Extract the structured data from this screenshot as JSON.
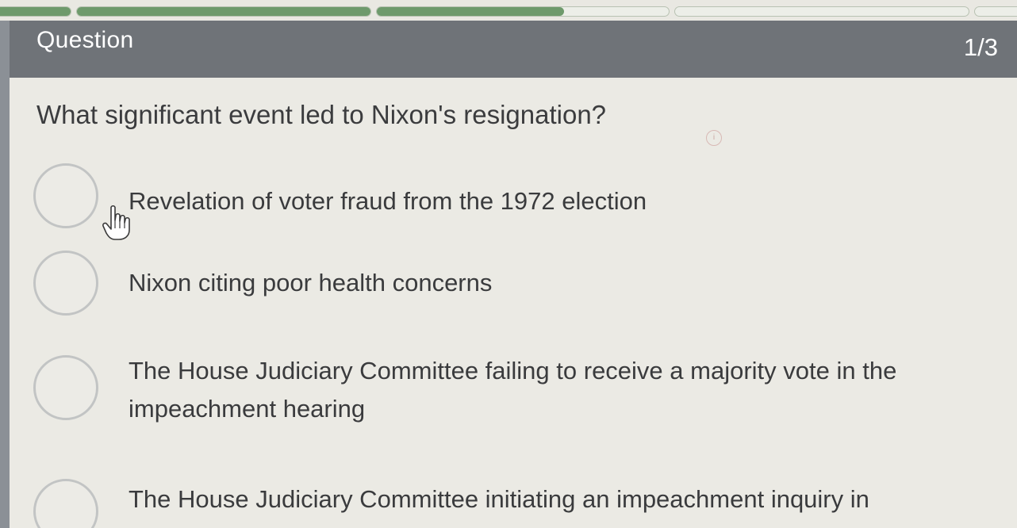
{
  "header": {
    "title": "Question",
    "counter": "1/3"
  },
  "progress": {
    "segments": [
      {
        "fill": 1.0
      },
      {
        "fill": 1.0
      },
      {
        "fill": 0.64
      },
      {
        "fill": 0.0
      },
      {
        "fill": 0.0
      }
    ]
  },
  "question": {
    "text": "What significant event led to Nixon's resignation?"
  },
  "options": [
    {
      "label": "Revelation of voter fraud from the 1972 election"
    },
    {
      "label": "Nixon citing poor health concerns"
    },
    {
      "label": "The House Judiciary Committee failing to receive a majority vote in the impeachment hearing"
    },
    {
      "label": "The House Judiciary Committee initiating an impeachment inquiry in"
    }
  ],
  "icons": {
    "cursor": "hand-pointer-icon",
    "radio": "radio-circle-icon"
  }
}
